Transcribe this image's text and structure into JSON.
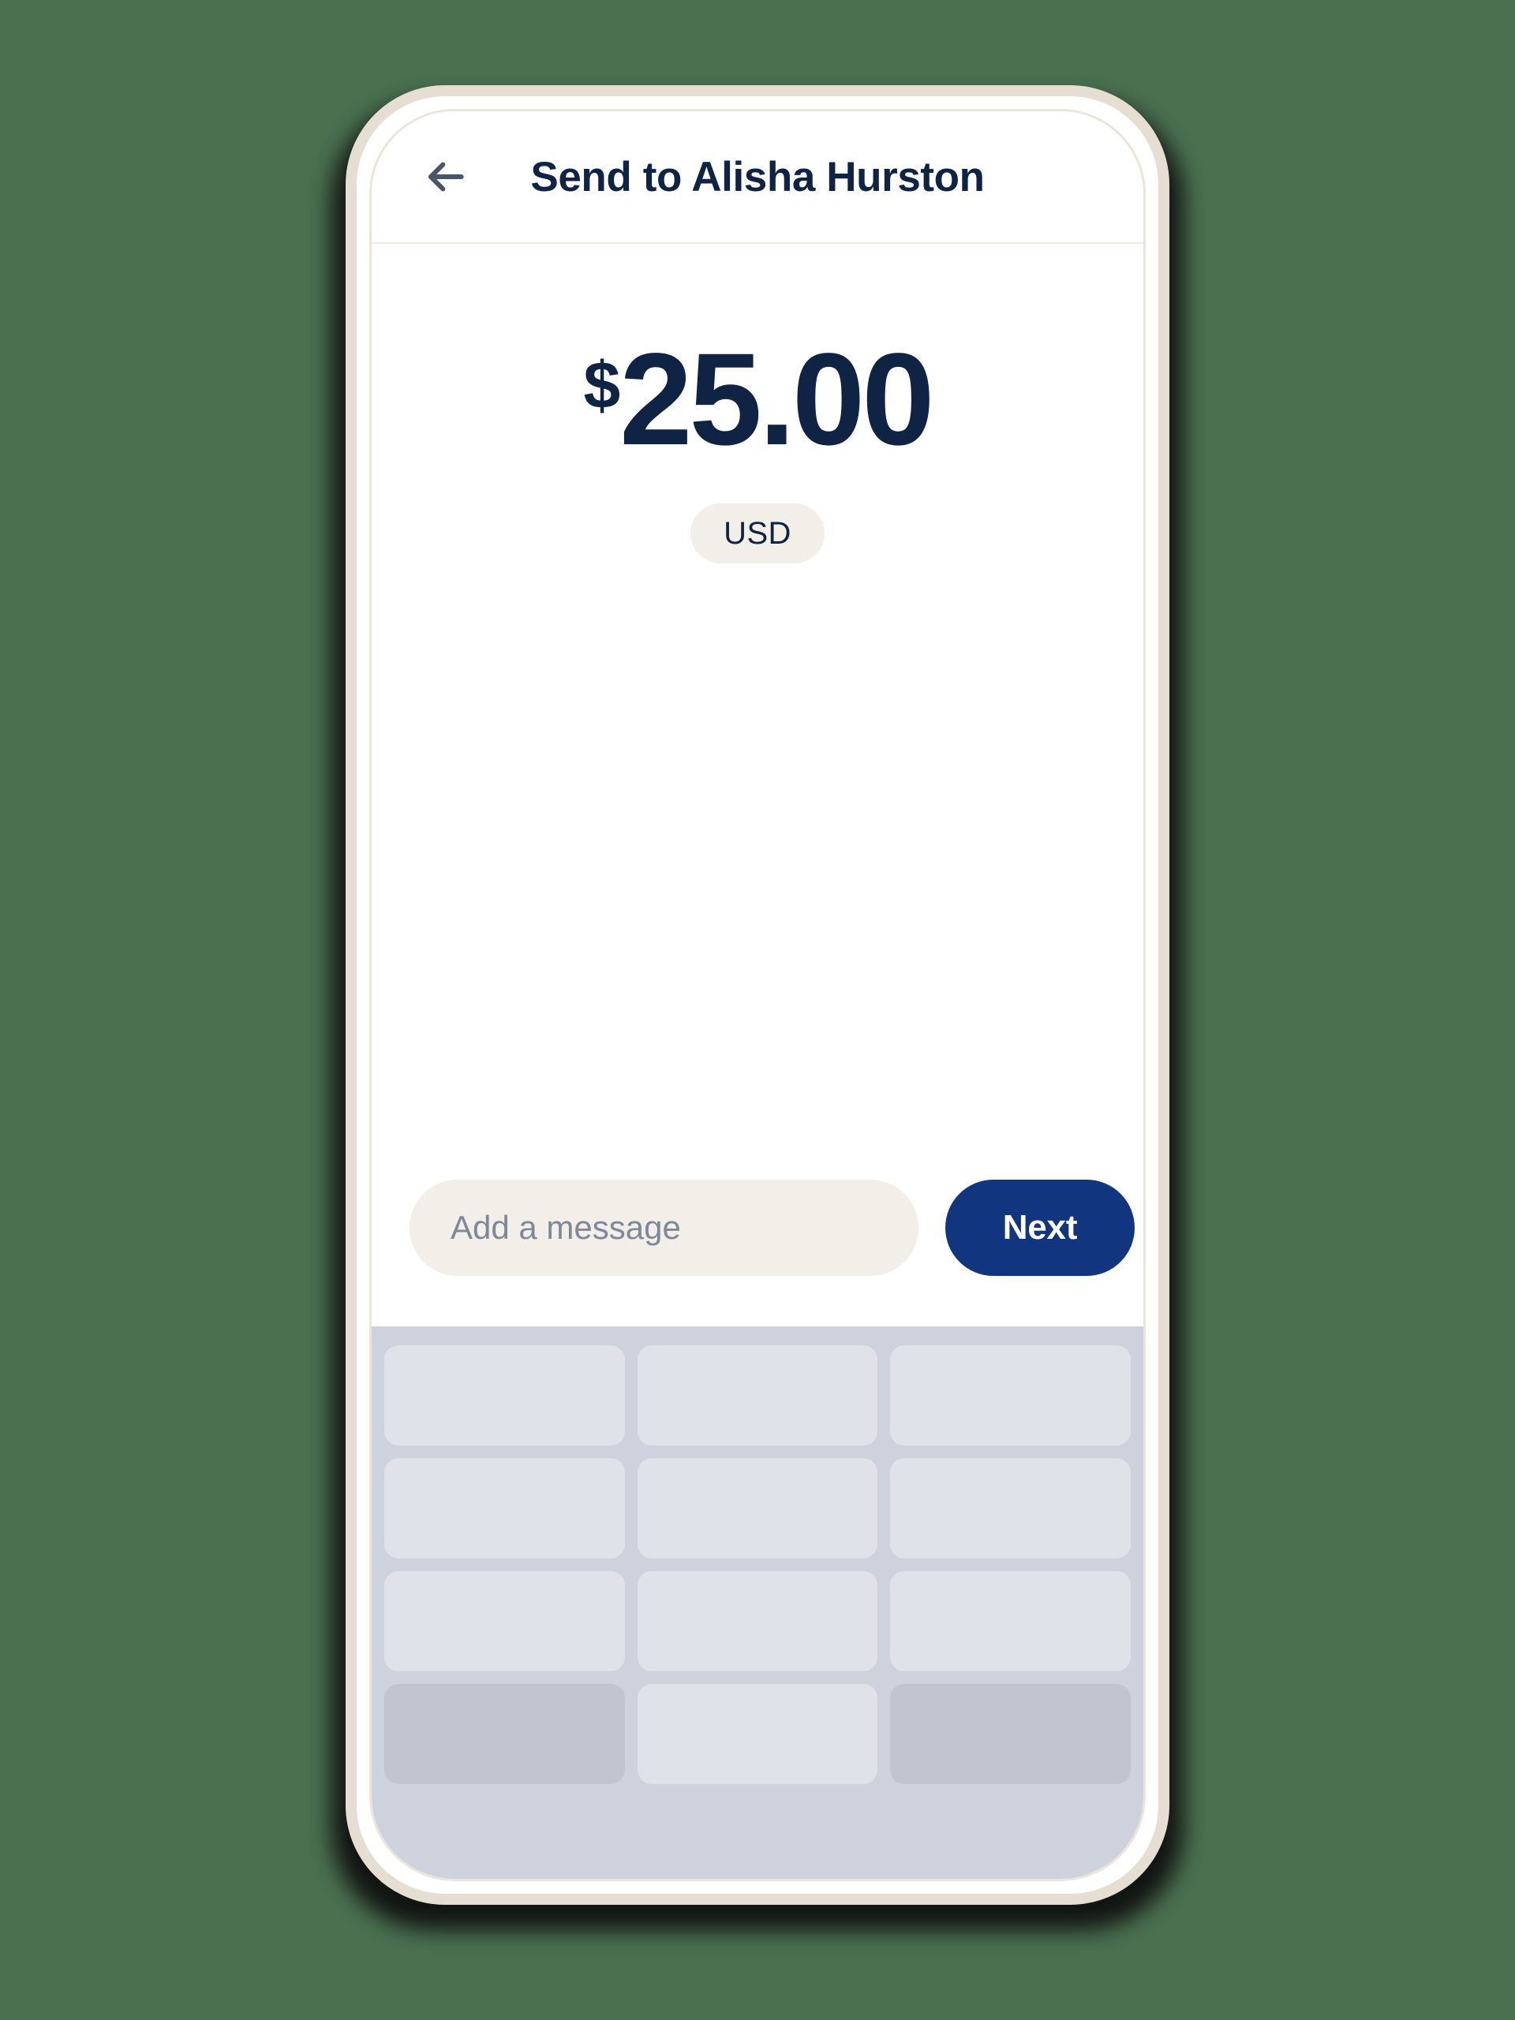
{
  "theme": {
    "background": "#4a7050",
    "bezel": "#e6ddd3",
    "screen": "#ffffff",
    "accent_navy": "#11357f",
    "text_navy": "#0f2345",
    "badge_bg": "#f2eee8",
    "placeholder": "#7e8899",
    "keyboard_bg": "#ced2dc",
    "key_bg": "#dfe2e8",
    "key_dark_bg": "#c0c5cf",
    "arrow": "#4a5568"
  },
  "header": {
    "back_icon": "arrow-left-icon",
    "title": "Send to Alisha Hurston"
  },
  "amount": {
    "currency_symbol": "$",
    "value": "25.00",
    "currency_code": "USD"
  },
  "compose": {
    "message_value": "",
    "message_placeholder": "Add a message",
    "next_label": "Next"
  },
  "keyboard": {
    "rows": [
      [
        {
          "name": "key-1",
          "style": "light"
        },
        {
          "name": "key-2",
          "style": "light"
        },
        {
          "name": "key-3",
          "style": "light"
        }
      ],
      [
        {
          "name": "key-4",
          "style": "light"
        },
        {
          "name": "key-5",
          "style": "light"
        },
        {
          "name": "key-6",
          "style": "light"
        }
      ],
      [
        {
          "name": "key-7",
          "style": "light"
        },
        {
          "name": "key-8",
          "style": "light"
        },
        {
          "name": "key-9",
          "style": "light"
        }
      ],
      [
        {
          "name": "key-function-left",
          "style": "dark"
        },
        {
          "name": "key-0",
          "style": "light"
        },
        {
          "name": "key-function-right",
          "style": "dark"
        }
      ]
    ]
  }
}
